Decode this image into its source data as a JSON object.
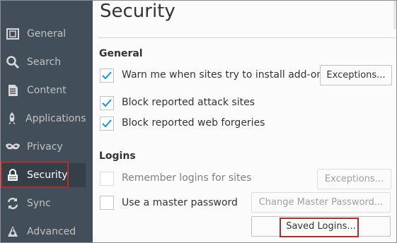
{
  "sidebar": {
    "items": [
      {
        "label": "General",
        "icon": "general-icon"
      },
      {
        "label": "Search",
        "icon": "search-icon"
      },
      {
        "label": "Content",
        "icon": "content-icon"
      },
      {
        "label": "Applications",
        "icon": "applications-icon"
      },
      {
        "label": "Privacy",
        "icon": "privacy-mask-icon"
      },
      {
        "label": "Security",
        "icon": "lock-icon",
        "selected": true
      },
      {
        "label": "Sync",
        "icon": "sync-icon"
      },
      {
        "label": "Advanced",
        "icon": "advanced-icon"
      }
    ]
  },
  "main": {
    "title": "Security",
    "general": {
      "heading": "General",
      "warn_addons": {
        "label": "Warn me when sites try to install add-ons",
        "checked": true
      },
      "exceptions_label": "Exceptions...",
      "block_attack": {
        "label": "Block reported attack sites",
        "checked": true
      },
      "block_forgeries": {
        "label": "Block reported web forgeries",
        "checked": true
      }
    },
    "logins": {
      "heading": "Logins",
      "remember": {
        "label": "Remember logins for sites",
        "checked": false
      },
      "exceptions_label": "Exceptions...",
      "master": {
        "label": "Use a master password",
        "checked": false
      },
      "change_master_label": "Change Master Password...",
      "saved_logins_label": "Saved Logins..."
    }
  },
  "colors": {
    "sidebar_bg": "#424f5a",
    "checkmark": "#0996f8",
    "highlight_border": "#b22d2d"
  }
}
